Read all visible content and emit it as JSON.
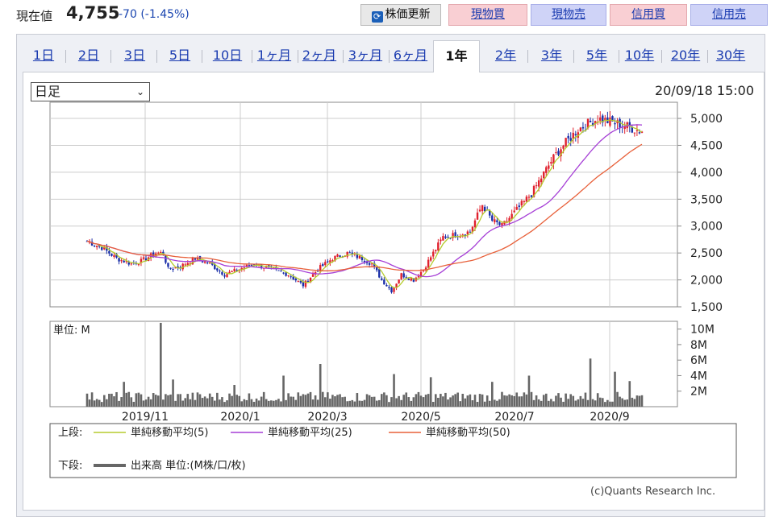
{
  "header": {
    "price_label": "現在値",
    "price_value": "4,755",
    "price_change": "-70 (-1.45%)",
    "refresh_label": "株価更新",
    "buy_spot_label": "現物買",
    "sell_spot_label": "現物売",
    "buy_margin_label": "信用買",
    "sell_margin_label": "信用売"
  },
  "tabs": [
    "1日",
    "2日",
    "3日",
    "5日",
    "10日",
    "1ヶ月",
    "2ヶ月",
    "3ヶ月",
    "6ヶ月",
    "1年",
    "2年",
    "3年",
    "5年",
    "10年",
    "20年",
    "30年"
  ],
  "active_tab": "1年",
  "selector": {
    "value": "日足"
  },
  "timestamp": "20/09/18 15:00",
  "legend": {
    "upper_label": "上段:",
    "lower_label": "下段:",
    "items": [
      {
        "label": "単純移動平均(5)",
        "color": "#b5cc2e"
      },
      {
        "label": "単純移動平均(25)",
        "color": "#a63fd6"
      },
      {
        "label": "単純移動平均(50)",
        "color": "#e8603a"
      }
    ],
    "volume_label": "出来高 単位:(M株/口/枚)",
    "volume_color": "#666666"
  },
  "copyright": "(c)Quants Research Inc.",
  "chart_data": [
    {
      "type": "candlestick",
      "ylim": [
        1500,
        5300
      ],
      "yticks": [
        "5,000",
        "4,500",
        "4,000",
        "3,500",
        "3,000",
        "2,500",
        "2,000",
        "1,500"
      ],
      "xticks": [
        "2019/11",
        "2020/1",
        "2020/3",
        "2020/5",
        "2020/7",
        "2020/9"
      ],
      "colors": {
        "up": "#e0212e",
        "down": "#1a2fa8"
      },
      "close_path": [
        [
          0,
          2720
        ],
        [
          6,
          2600
        ],
        [
          12,
          2400
        ],
        [
          18,
          2300
        ],
        [
          22,
          2350
        ],
        [
          28,
          2500
        ],
        [
          31,
          2500
        ],
        [
          33,
          2200
        ],
        [
          38,
          2250
        ],
        [
          44,
          2400
        ],
        [
          50,
          2300
        ],
        [
          56,
          2100
        ],
        [
          62,
          2200
        ],
        [
          68,
          2300
        ],
        [
          75,
          2200
        ],
        [
          82,
          2100
        ],
        [
          88,
          1900
        ],
        [
          94,
          2200
        ],
        [
          100,
          2400
        ],
        [
          106,
          2500
        ],
        [
          112,
          2400
        ],
        [
          116,
          2300
        ],
        [
          120,
          2000
        ],
        [
          124,
          1800
        ],
        [
          128,
          2100
        ],
        [
          133,
          2000
        ],
        [
          137,
          2200
        ],
        [
          141,
          2500
        ],
        [
          145,
          2800
        ],
        [
          152,
          2850
        ],
        [
          156,
          2900
        ],
        [
          158,
          3100
        ],
        [
          161,
          3400
        ],
        [
          165,
          3100
        ],
        [
          169,
          3000
        ],
        [
          173,
          3200
        ],
        [
          177,
          3400
        ],
        [
          181,
          3600
        ],
        [
          185,
          3900
        ],
        [
          189,
          4200
        ],
        [
          192,
          4400
        ],
        [
          196,
          4600
        ],
        [
          200,
          4800
        ],
        [
          204,
          4900
        ],
        [
          208,
          5000
        ],
        [
          212,
          4950
        ],
        [
          216,
          4900
        ],
        [
          220,
          4850
        ],
        [
          226,
          4755
        ]
      ],
      "ma5_color": "#b5cc2e",
      "ma25_color": "#a63fd6",
      "ma50_color": "#e8603a"
    },
    {
      "type": "bar",
      "title": "単位: M",
      "ylim": [
        0,
        11
      ],
      "yticks": [
        "10M",
        "8M",
        "6M",
        "4M",
        "2M"
      ],
      "spikes": [
        [
          15,
          3.2
        ],
        [
          30,
          10.8
        ],
        [
          35,
          3.5
        ],
        [
          60,
          2.8
        ],
        [
          80,
          4.0
        ],
        [
          95,
          5.5
        ],
        [
          125,
          4.2
        ],
        [
          140,
          3.8
        ],
        [
          165,
          3.2
        ],
        [
          180,
          4.0
        ],
        [
          205,
          6.2
        ],
        [
          215,
          4.5
        ],
        [
          221,
          3.3
        ]
      ],
      "base_level": 1.2,
      "color": "#666666"
    }
  ]
}
